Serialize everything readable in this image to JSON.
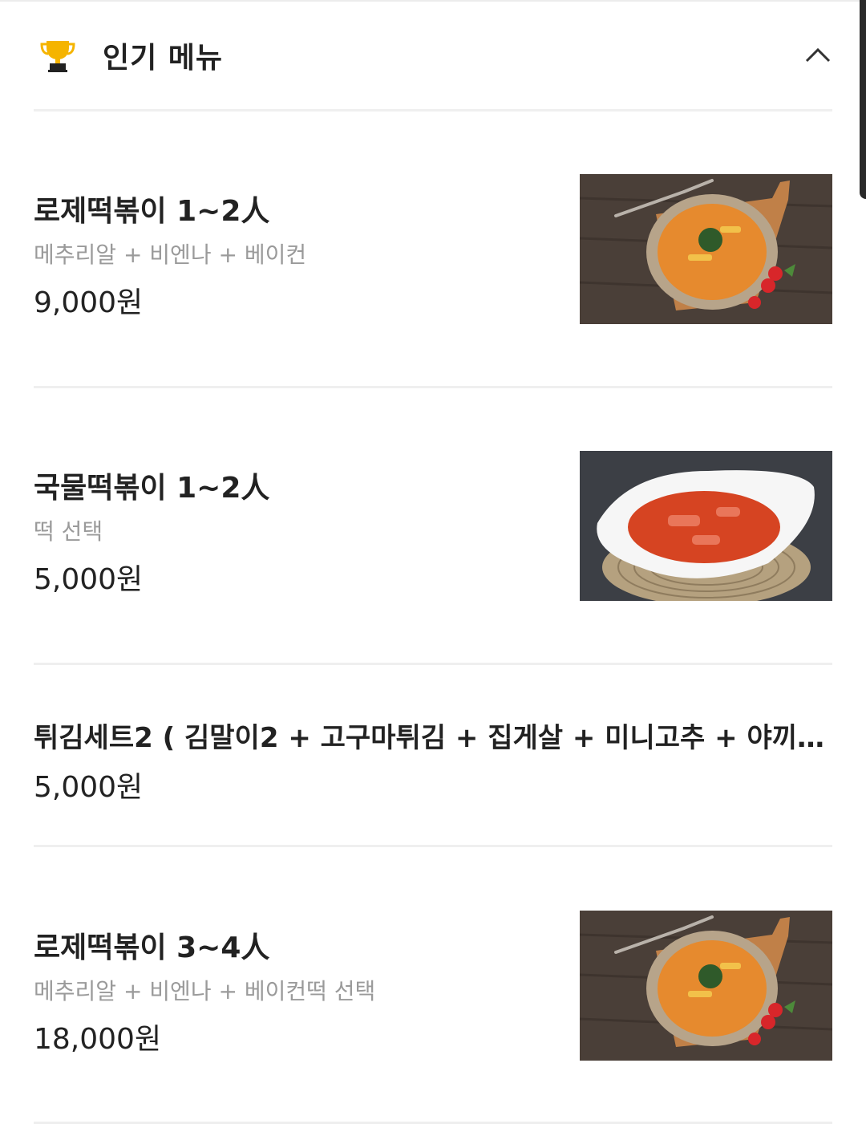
{
  "section": {
    "title": "인기 메뉴",
    "icon": "trophy-icon",
    "collapse_icon": "chevron-up-icon"
  },
  "menu_items": [
    {
      "name": "로제떡볶이 1~2人",
      "description": "메추리알 + 비엔나 + 베이컨",
      "price": "9,000원",
      "image": "rose-tteokbokki-plate-image"
    },
    {
      "name": "국물떡볶이 1~2人",
      "description": "떡 선택",
      "price": "5,000원",
      "image": "soup-tteokbokki-bowl-image"
    },
    {
      "name": "튀김세트2 ( 김말이2 + 고구마튀김 + 집게살 + 미니고추 + 야끼…",
      "price": "5,000원"
    },
    {
      "name": "로제떡볶이 3~4人",
      "description": "메추리알 + 비엔나 + 베이컨떡 선택",
      "price": "18,000원",
      "image": "rose-tteokbokki-plate-image"
    }
  ],
  "colors": {
    "trophy": "#F5B400",
    "text": "#222222",
    "muted": "#9A9A9A",
    "divider": "#EFEFEF"
  }
}
